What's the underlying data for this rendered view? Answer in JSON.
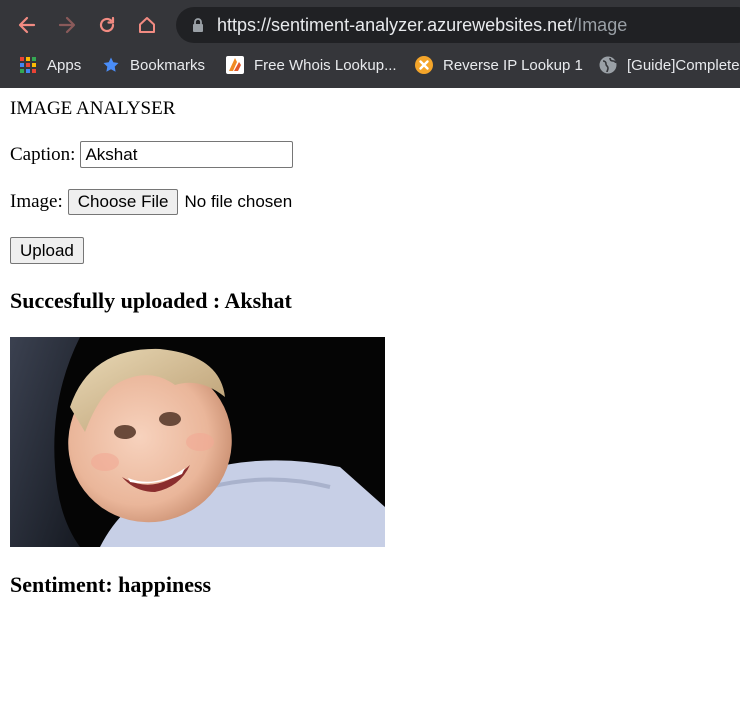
{
  "browser": {
    "url_domain": "https://sentiment-analyzer.azurewebsites.net",
    "url_path": "/Image",
    "accent_color": "#f28b82",
    "bookmarks": [
      {
        "label": "Apps",
        "icon": "apps-grid-icon"
      },
      {
        "label": "Bookmarks",
        "icon": "star-icon"
      },
      {
        "label": "Free Whois Lookup...",
        "icon": "whois-site-icon"
      },
      {
        "label": "Reverse IP Lookup 1",
        "icon": "reverse-ip-site-icon"
      },
      {
        "label": "[Guide]Complete",
        "icon": "globe-icon"
      }
    ]
  },
  "page": {
    "heading": "IMAGE ANALYSER",
    "caption_label": "Caption:",
    "caption_value": "Akshat",
    "image_label": "Image:",
    "choose_file_label": "Choose File",
    "file_status": "No file chosen",
    "upload_label": "Upload",
    "success_message": "Succesfully uploaded : Akshat",
    "sentiment_message": "Sentiment: happiness"
  }
}
